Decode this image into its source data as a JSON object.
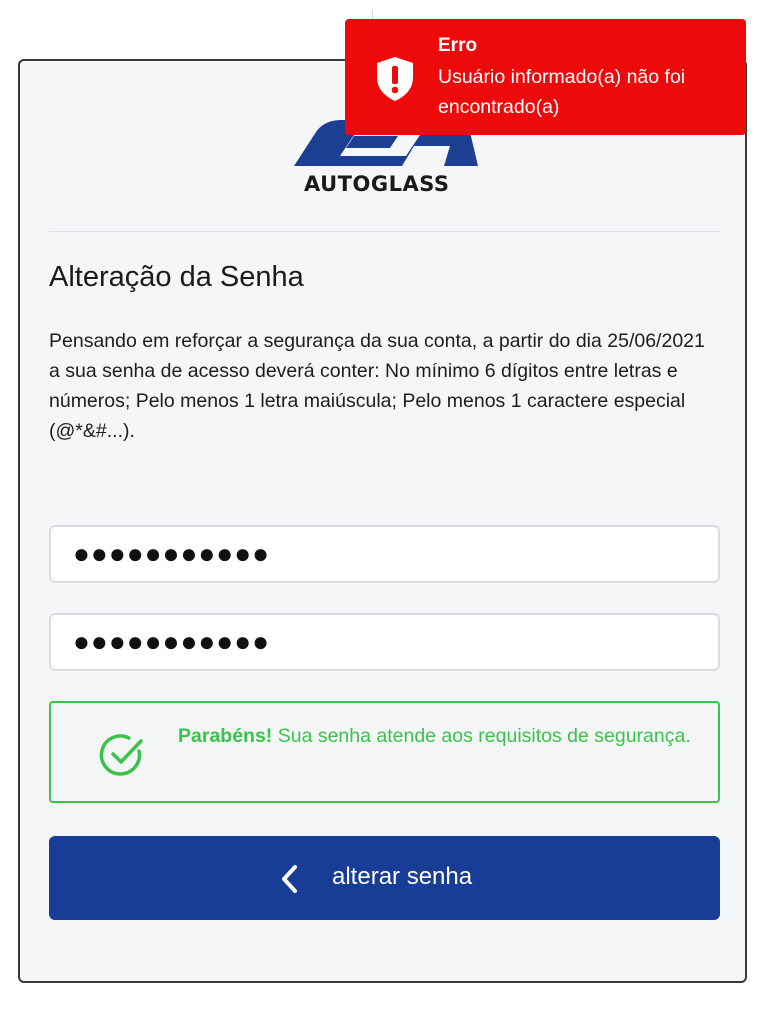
{
  "toast": {
    "title": "Erro",
    "message": "Usuário informado(a) não foi encontrado(a)",
    "color": "#ee0a0a",
    "icon": "shield-alert-icon"
  },
  "logo": {
    "text": "AUTOGLASS",
    "color": "#1c3f93"
  },
  "form": {
    "title": "Alteração da Senha",
    "description": "Pensando em reforçar a segurança da sua conta, a partir do dia 25/06/2021 a sua senha de acesso deverá conter: No mínimo 6 dígitos entre letras e números; Pelo menos 1 letra maiúscula; Pelo menos 1 caractere especial (@*&#...).",
    "password": "●●●●●●●●●●●",
    "password_confirm": "●●●●●●●●●●●"
  },
  "success": {
    "strong": "Parabéns!",
    "text": " Sua senha atende aos requisitos de segurança.",
    "color": "#3cc24a",
    "icon": "check-circle-icon"
  },
  "button": {
    "label": "alterar senha",
    "icon": "chevron-left-icon",
    "color": "#173d97"
  }
}
